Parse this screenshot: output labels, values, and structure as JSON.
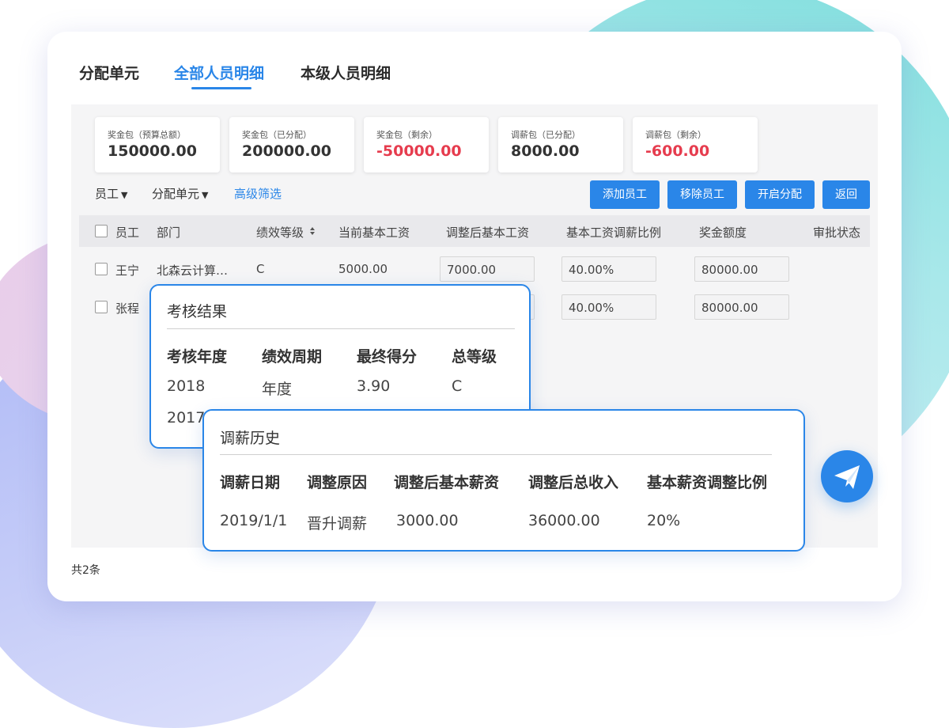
{
  "tabs": [
    {
      "label": "分配单元"
    },
    {
      "label": "全部人员明细"
    },
    {
      "label": "本级人员明细"
    }
  ],
  "stats": [
    {
      "label": "奖金包（预算总额）",
      "value": "150000.00"
    },
    {
      "label": "奖金包（已分配）",
      "value": "200000.00"
    },
    {
      "label": "奖金包（剩余）",
      "value": "-50000.00"
    },
    {
      "label": "调薪包（已分配）",
      "value": "8000.00"
    },
    {
      "label": "调薪包（剩余）",
      "value": "-600.00"
    }
  ],
  "filters": {
    "employee": "员工",
    "unit": "分配单元",
    "advanced": "高级筛选"
  },
  "buttons": {
    "add": "添加员工",
    "remove": "移除员工",
    "start": "开启分配",
    "back": "返回"
  },
  "table": {
    "headers": [
      "员工",
      "部门",
      "绩效等级",
      "当前基本工资",
      "调整后基本工资",
      "基本工资调薪比例",
      "奖金额度",
      "审批状态"
    ],
    "rows": [
      {
        "name": "王宁",
        "dept": "北森云计算…",
        "grade": "C",
        "current": "5000.00",
        "adjusted": "7000.00",
        "ratio": "40.00%",
        "bonus": "80000.00"
      },
      {
        "name": "张程",
        "ratio": "40.00%",
        "bonus": "80000.00"
      }
    ],
    "total": "共2条"
  },
  "appraisal": {
    "title": "考核结果",
    "headers": [
      "考核年度",
      "绩效周期",
      "最终得分",
      "总等级"
    ],
    "rows": [
      [
        "2018",
        "年度",
        "3.90",
        "C"
      ],
      [
        "2017"
      ]
    ]
  },
  "salary_history": {
    "title": "调薪历史",
    "headers": [
      "调薪日期",
      "调整原因",
      "调整后基本薪资",
      "调整后总收入",
      "基本薪资调整比例"
    ],
    "rows": [
      [
        "2019/1/1",
        "晋升调薪",
        "3000.00",
        "36000.00",
        "20%"
      ]
    ]
  },
  "colors": {
    "accent": "#2a86e8",
    "negative": "#e63c4e"
  },
  "icons": {
    "fab": "paper-plane-icon",
    "dropdown": "caret-down-icon",
    "sort": "sort-icon"
  }
}
